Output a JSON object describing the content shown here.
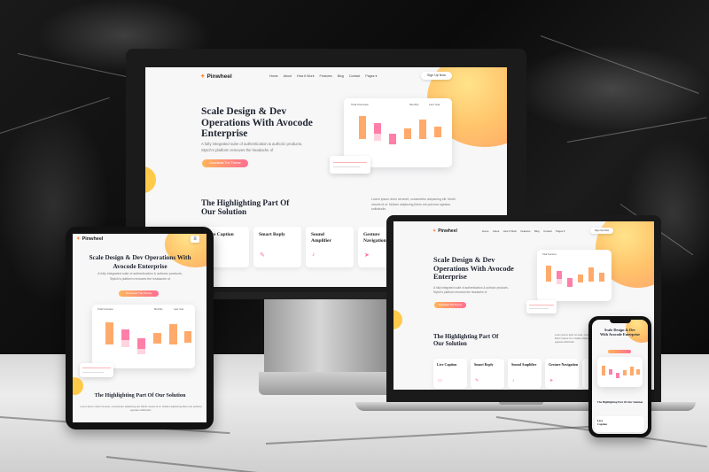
{
  "brand": {
    "logo": "Pinwheel",
    "accent": "#ff6f91",
    "accent2": "#ffb45a"
  },
  "nav": {
    "items": [
      "Home",
      "About",
      "How It Work",
      "Features",
      "Blog",
      "Contact",
      "Pages"
    ],
    "pages_caret": "▾",
    "cta": "Sign Up Now"
  },
  "hero": {
    "title": "Scale Design & Dev Operations With Avocode Enterprise",
    "title_lines": [
      "Scale Design & Dev",
      "Operations With Avocode",
      "Enterprise"
    ],
    "text": "A fully integrated suite of authentication & authoriz products, Stytch's platform removes the headache of",
    "text_lines": [
      "A fully integrated suite of authentication & authoriz products,",
      "Stytch's platform removes the headache of"
    ],
    "button": "Download The Theme"
  },
  "dashboard": {
    "title": "Total Overview",
    "filter1": "Monthly",
    "filter2": "Last Year"
  },
  "section": {
    "title": "The Highlighting Part Of Our Solution",
    "title_lines": [
      "The Highlighting Part Of",
      "Our Solution"
    ],
    "text": "Lorem ipsum dolor sit amet, consectetur adipiscing elit. Morbi mauris id ut. Nullam adipiscing libero est pulvinar egestas sollicitudin."
  },
  "features": [
    {
      "title": "Live Caption",
      "icon": "caption-icon"
    },
    {
      "title": "Smart Reply",
      "icon": "paperclip-icon"
    },
    {
      "title": "Sound Amplifier",
      "icon": "bell-icon"
    },
    {
      "title": "Gesture Navigation",
      "icon": "navigation-icon"
    }
  ],
  "icons": {
    "menu": "hamburger-icon",
    "logo_star": "star-icon"
  }
}
